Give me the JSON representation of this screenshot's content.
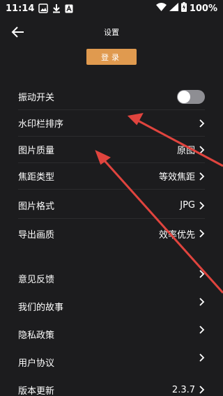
{
  "status_bar": {
    "time": "11:14",
    "battery": "100%"
  },
  "header": {
    "title": "设置"
  },
  "login_button": "登录",
  "settings": {
    "vibration": "振动开关",
    "watermark_sort": "水印栏排序",
    "image_quality": {
      "label": "图片质量",
      "value": "原图"
    },
    "focal_type": {
      "label": "焦距类型",
      "value": "等效焦距"
    },
    "image_format": {
      "label": "图片格式",
      "value": "JPG"
    },
    "export_quality": {
      "label": "导出画质",
      "value": "效率优先"
    },
    "feedback": "意见反馈",
    "our_story": "我们的故事",
    "privacy": "隐私政策",
    "agreement": "用户协议",
    "version": {
      "label": "版本更新",
      "value": "2.3.7"
    }
  },
  "colors": {
    "background": "#1c1c1e",
    "accent": "#e09a4f",
    "annotation_arrow": "#e0443e"
  }
}
